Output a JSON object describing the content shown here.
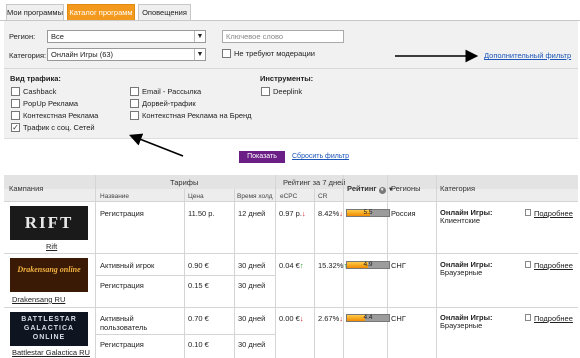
{
  "tabs": [
    {
      "label": "Мои программы"
    },
    {
      "label": "Каталог программ"
    },
    {
      "label": "Оповещения"
    }
  ],
  "filters": {
    "region_label": "Регион:",
    "region_value": "Все",
    "category_label": "Категория:",
    "category_value": "Онлайн Игры (63)",
    "keyword_placeholder": "Ключевое слово",
    "no_moderation_label": "Не требуют модерации",
    "additional_filter": "Дополнительный фильтр",
    "traffic_heading": "Вид трафика:",
    "traffic_left": [
      {
        "label": "Cashback",
        "checked": false
      },
      {
        "label": "PopUp Реклама",
        "checked": false
      },
      {
        "label": "Контекстная Реклама",
        "checked": false
      },
      {
        "label": "Трафик с соц. Сетей",
        "checked": true
      }
    ],
    "traffic_right": [
      {
        "label": "Email - Рассылка",
        "checked": false
      },
      {
        "label": "Дорвей-трафик",
        "checked": false
      },
      {
        "label": "Контекстная Реклама на Бренд",
        "checked": false
      }
    ],
    "tools_heading": "Инструменты:",
    "tools": [
      {
        "label": "Deeplink",
        "checked": false
      }
    ],
    "show_button": "Показать",
    "reset_link": "Сбросить фильтр"
  },
  "table": {
    "headers": {
      "campaign": "Кампания",
      "tariffs": "Тарифы",
      "rating7": "Рейтинг за 7 дней",
      "rating": "Рейтинг",
      "regions": "Регионы",
      "category": "Категория",
      "name": "Название",
      "price": "Цена",
      "hold": "Время холд",
      "ecpc": "eCPC",
      "cr": "CR"
    },
    "rows": [
      {
        "campaign": "Rift",
        "logo_text": "RIFT",
        "tariffs": [
          {
            "name": "Регистрация",
            "price": "11.50 р.",
            "hold": "12 дней"
          }
        ],
        "ecpc": "0.97 р.",
        "ecpc_trend": "down",
        "cr": "8.42%",
        "cr_trend": "down",
        "rating": "5.5",
        "rating_fraction": 0.55,
        "region": "Россия",
        "category_main": "Онлайн Игры:",
        "category_sub": "Клиентские",
        "details": "Подробнее"
      },
      {
        "campaign": "Drakensang RU",
        "logo_text": "Drakensang online",
        "tariffs": [
          {
            "name": "Активный игрок",
            "price": "0.90 €",
            "hold": "30 дней"
          },
          {
            "name": "Регистрация",
            "price": "0.15 €",
            "hold": "30 дней"
          }
        ],
        "ecpc": "0.04 €",
        "ecpc_trend": "up",
        "cr": "15.32%",
        "cr_trend": "up",
        "rating": "4.9",
        "rating_fraction": 0.49,
        "region": "СНГ",
        "category_main": "Онлайн Игры:",
        "category_sub": "Браузерные",
        "details": "Подробнее"
      },
      {
        "campaign": "Battlestar Galactica RU",
        "logo_text": "BATTLESTAR GALACTICA ONLINE",
        "tariffs": [
          {
            "name": "Активный пользователь",
            "price": "0.70 €",
            "hold": "30 дней"
          },
          {
            "name": "Регистрация",
            "price": "0.10 €",
            "hold": "30 дней"
          }
        ],
        "ecpc": "0.00 €",
        "ecpc_trend": "down",
        "cr": "2.67%",
        "cr_trend": "down",
        "rating": "4.4",
        "rating_fraction": 0.44,
        "region": "СНГ",
        "category_main": "Онлайн Игры:",
        "category_sub": "Браузерные",
        "details": "Подробнее"
      }
    ]
  },
  "colors": {
    "active_tab": "#f39a1e",
    "button": "#6b1f86",
    "link": "#1b56b8"
  }
}
